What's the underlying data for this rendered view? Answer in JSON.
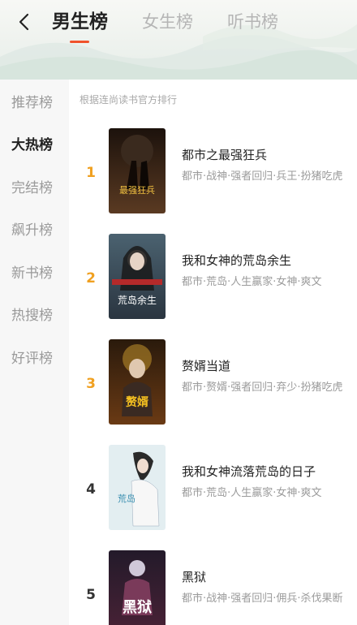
{
  "header": {
    "back_icon": "chevron-left-icon",
    "tabs": [
      {
        "label": "男生榜",
        "active": true
      },
      {
        "label": "女生榜",
        "active": false
      },
      {
        "label": "听书榜",
        "active": false
      }
    ],
    "accent_color": "#f0522b"
  },
  "sidebar": {
    "items": [
      {
        "label": "推荐榜",
        "active": false
      },
      {
        "label": "大热榜",
        "active": true
      },
      {
        "label": "完结榜",
        "active": false
      },
      {
        "label": "飙升榜",
        "active": false
      },
      {
        "label": "新书榜",
        "active": false
      },
      {
        "label": "热搜榜",
        "active": false
      },
      {
        "label": "好评榜",
        "active": false
      }
    ]
  },
  "main": {
    "hint": "根据连尚读书官方排行",
    "books": [
      {
        "rank": "1",
        "title": "都市之最强狂兵",
        "tags": "都市·战神·强者回归·兵王·扮猪吃虎",
        "cover_text": "最强狂兵",
        "cover_colors": [
          "#2b1a12",
          "#5a3a22"
        ]
      },
      {
        "rank": "2",
        "title": "我和女神的荒岛余生",
        "tags": "都市·荒岛·人生赢家·女神·爽文",
        "cover_text": "荒岛余生",
        "cover_colors": [
          "#3a4a55",
          "#6f8894"
        ]
      },
      {
        "rank": "3",
        "title": "赘婿当道",
        "tags": "都市·赘婿·强者回归·弃少·扮猪吃虎",
        "cover_text": "赘婿",
        "cover_colors": [
          "#4a2a12",
          "#b07a2a"
        ]
      },
      {
        "rank": "4",
        "title": "我和女神流落荒岛的日子",
        "tags": "都市·荒岛·人生赢家·女神·爽文",
        "cover_text": "荒岛",
        "cover_colors": [
          "#cfe6ef",
          "#e8f1f3"
        ]
      },
      {
        "rank": "5",
        "title": "黑狱",
        "tags": "都市·战神·强者回归·佣兵·杀伐果断",
        "cover_text": "黑狱",
        "cover_colors": [
          "#1a1520",
          "#5a3048"
        ]
      }
    ]
  }
}
